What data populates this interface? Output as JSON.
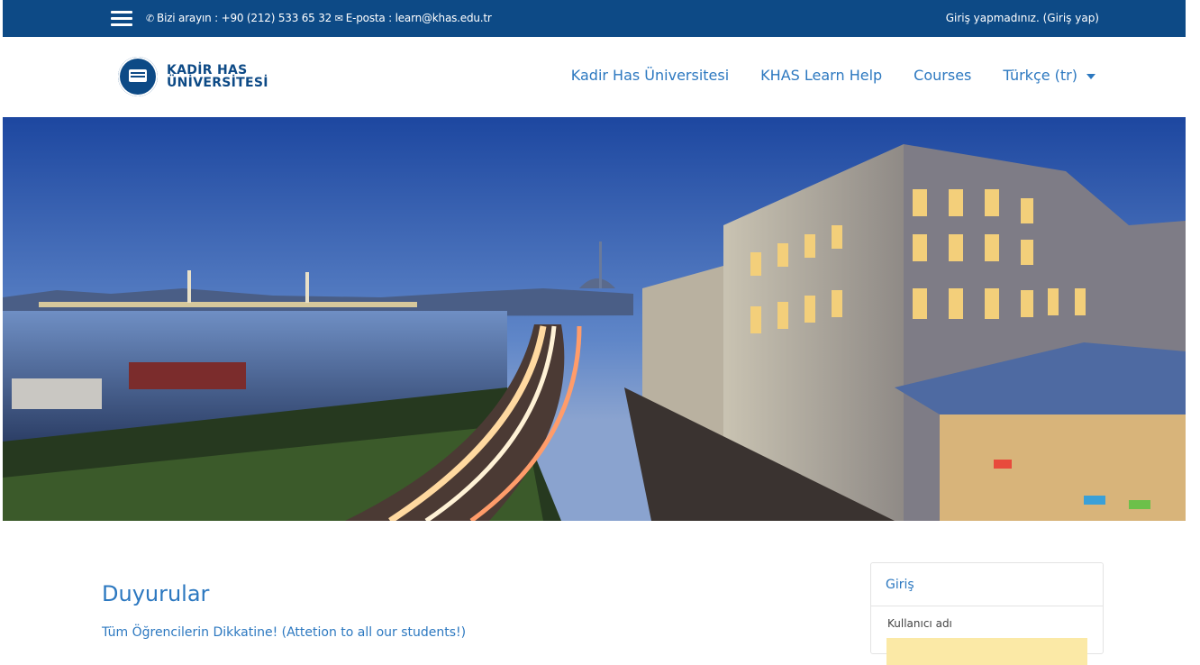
{
  "topbar": {
    "phone_label": "Bizi arayın : +90 (212) 533 65 32",
    "email_label": "E-posta : learn@khas.edu.tr",
    "login_status": "Giriş yapmadınız. (Giriş yap)",
    "background_color": "#0d4a86"
  },
  "navbar": {
    "logo_line1": "KADİR HAS",
    "logo_line2": "ÜNİVERSİTESİ",
    "links": [
      "Kadir Has Üniversitesi",
      "KHAS Learn Help",
      "Courses",
      "Türkçe (tr)"
    ],
    "accent_color": "#2c78c0"
  },
  "main": {
    "title": "Duyurular",
    "announcement": "Tüm Öğrencilerin Dikkatine! (Attetion to all our students!)"
  },
  "login_block": {
    "title": "Giriş",
    "username_label": "Kullanıcı adı"
  },
  "icons": {
    "menu": "hamburger-menu-icon",
    "phone": "phone-icon",
    "email": "envelope-icon",
    "dropdown": "caret-down-icon"
  }
}
